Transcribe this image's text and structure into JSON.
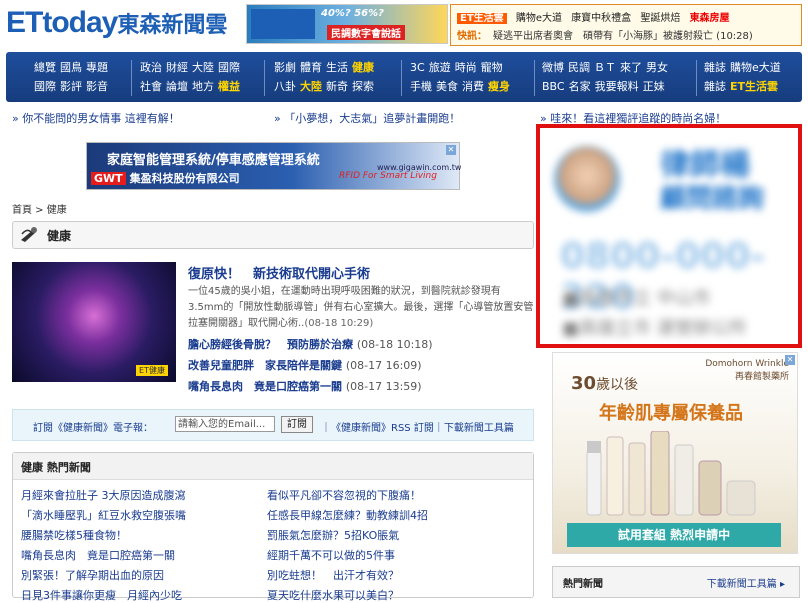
{
  "header": {
    "logo_en": "ETtoday",
    "logo_cn": "東森新聞雲",
    "banner_ad": {
      "percent_text": "40%? 56%?",
      "sub_text": "民調數字會說話"
    },
    "top_links": [
      "ET生活雲",
      "購物e大道",
      "康寶中秋禮盒",
      "聖誕烘焙",
      "東森房屋"
    ],
    "breaking": {
      "label": "快訊：",
      "text": "疑逃平出席者奧會　碩帶有「小海豚」被護射殺亡 (10:28)"
    }
  },
  "nav": {
    "groups": [
      {
        "row1": [
          "總覽",
          "國鳥",
          "專題"
        ],
        "row2": [
          "國際",
          "影評",
          "影音"
        ]
      },
      {
        "row1": [
          "政治",
          "財經",
          "大陸",
          "國際"
        ],
        "row2": [
          "社會",
          "論壇",
          "地方",
          "權益"
        ]
      },
      {
        "row1": [
          "影劇",
          "體育",
          "生活",
          "健康"
        ],
        "row2": [
          "八卦",
          "大陸",
          "新奇",
          "探索"
        ]
      },
      {
        "row1": [
          "3C",
          "旅遊",
          "時尚",
          "寵物"
        ],
        "row2": [
          "手機",
          "美食",
          "消費",
          "瘦身"
        ]
      },
      {
        "row1": [
          "微博",
          "民調",
          "ＢＴ",
          "來了",
          "男女"
        ],
        "row2": [
          "BBC",
          "名家",
          "我要報料",
          "正妹"
        ]
      },
      {
        "row1": [
          "雜誌",
          "購物e大道"
        ],
        "row2": [
          "雜誌",
          "ET生活雲"
        ]
      }
    ]
  },
  "promos": [
    "» 你不能問的男女情事 這裡有解！",
    "» 「小夢想，大志氣」追夢計畫開跑！",
    "» 哇來！看這裡獨評追蹤的時尚名婦！"
  ],
  "mid_ad": {
    "title": "家庭智能管理系統/停車感應管理系統",
    "brand_tag": "GWT",
    "company": "集盈科技股份有限公司",
    "url": "www.gigawin.com.tw",
    "slogan": "RFID For Smart Living"
  },
  "breadcrumb": "首頁 > 健康",
  "section_title": "健康",
  "featured": {
    "title": "復原快！　新技術取代開心手術",
    "desc": "一位45歲的吳小姐，在運動時出現呼吸困難的狀況，到醫院就診發現有3.5mm的「開放性動脈導管」併有右心室擴大。最後，選擇「心導管放置安管拉塞開關器」取代開心術..",
    "date": "(08-18 10:29)",
    "img_label": "ET健康",
    "links": [
      {
        "text": "膽心膀經後骨脫？　預防勝於治療",
        "date": "(08-18 10:18)"
      },
      {
        "text": "改善兒童肥胖　家長陪伴是關鍵",
        "date": "(08-17 16:09)"
      },
      {
        "text": "嘴角長息肉　竟是口腔癌第一關",
        "date": "(08-17 13:59)"
      }
    ]
  },
  "subscribe": {
    "label": "訂閱《健康新聞》電子報：",
    "placeholder": "請輸入您的Email...",
    "button": "訂閱",
    "links": "｜《健康新聞》RSS 訂閱｜下載新聞工具篇"
  },
  "hot_news": {
    "title": "健康 熱門新聞",
    "left": [
      "月經來會拉肚子 3大原因造成腹瀉",
      "「滴水睡壓乳」紅豆水救空腹張嘴",
      "腰腸禁吃樣5種食物！",
      "嘴角長息肉　竟是口腔癌第一關",
      "別緊張！了解孕期出血的原因",
      "日見3件事讓你更瘦　月經內少吃"
    ],
    "right": [
      "看似平凡卻不容忽視的下腹痛！",
      "任感長甲線怎麼練？動教練訓4招",
      "罰脹氣怎麼辦？5招KO脹氣",
      "經期千萬不可以做的5件事",
      "別吃蛀想！　出汗才有效？",
      "夏天吃什麼水果可以美白？"
    ]
  },
  "right_ad": {
    "name": "律師楊",
    "sub": "顧問諮詢",
    "phone": "0800-000-320",
    "line1": "■高雄市立 中山市",
    "line2": "■高雄立市 運營辦公所"
  },
  "cosmetic_ad": {
    "brand": "Domohorn Wrinkle",
    "brand_sub": "再春館製藥所",
    "age_num": "30",
    "age_text": "歲以後",
    "headline": "年齡肌專屬保養品",
    "cta": "試用套組 熱烈申請中"
  },
  "hot_right": {
    "title": "熱門新聞",
    "link": "下載新聞工具篇 ▸"
  }
}
